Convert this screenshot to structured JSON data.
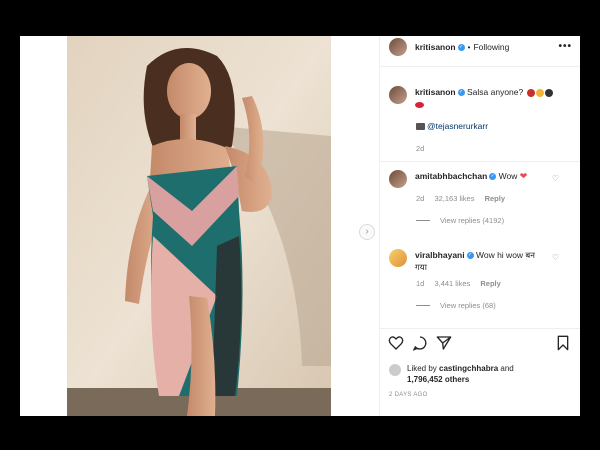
{
  "post": {
    "username": "kritisanon",
    "follow_status": "Following",
    "more_label": "•••",
    "next_label": "›"
  },
  "caption": {
    "username": "kritisanon",
    "text": "Salsa anyone?",
    "credit_mention": "@tejasnerurkarr",
    "time": "2d"
  },
  "comments": [
    {
      "username": "amitabhbachchan",
      "text": "Wow",
      "time": "2d",
      "likes": "32,163 likes",
      "reply": "Reply",
      "view_replies": "View replies (4192)"
    },
    {
      "username": "viralbhayani",
      "text": "Wow hi wow बन गया",
      "time": "1d",
      "likes": "3,441 likes",
      "reply": "Reply",
      "view_replies": "View replies (68)"
    }
  ],
  "liked_by": {
    "prefix": "Liked by",
    "user": "castingchhabra",
    "and": "and",
    "count": "1,796,452 others"
  },
  "posted": "2 DAYS AGO",
  "icons": [
    "more-options-icon",
    "verified-icon",
    "heart-icon",
    "comment-icon",
    "share-icon",
    "bookmark-icon",
    "camera-icon",
    "chevron-right-icon"
  ],
  "colors": {
    "verified": "#3897f0",
    "heart_red": "#ed4956",
    "dress_teal": "#1f6e6e",
    "dress_pink": "#d9a0a0",
    "wall": "#e8dccb"
  }
}
